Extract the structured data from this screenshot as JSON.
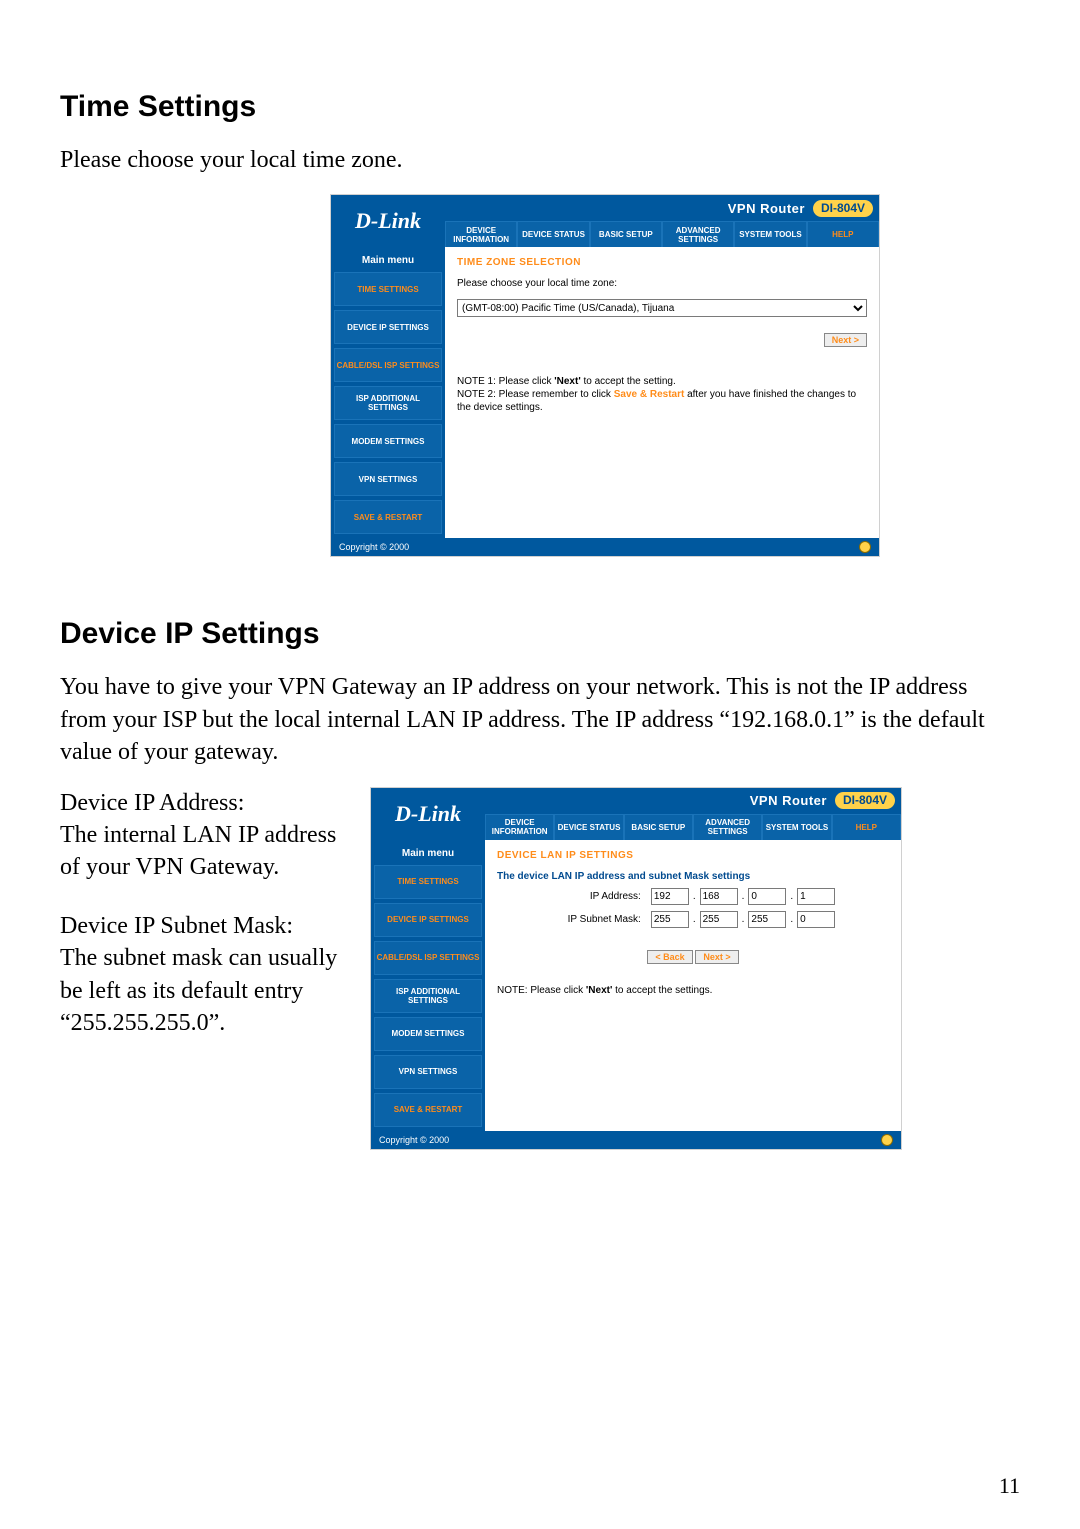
{
  "page_number": "11",
  "sec1": {
    "heading": "Time Settings",
    "intro": "Please choose your local time zone."
  },
  "sec2": {
    "heading": "Device IP Settings",
    "intro": "You have to give your VPN Gateway an IP address on your network. This is not the IP address from your ISP but the local internal LAN IP address. The IP address “192.168.0.1” is the default value of your gateway.",
    "left1_label": "Device IP Address:",
    "left1_body": "The internal LAN IP address of your VPN Gateway.",
    "left2_label": "Device IP Subnet Mask:",
    "left2_body": "The subnet mask can usually be left as its default entry “255.255.255.0”."
  },
  "router": {
    "logo": "D-Link",
    "title": "VPN Router",
    "model": "DI-804V",
    "tabs": [
      "DEVICE INFORMATION",
      "DEVICE STATUS",
      "BASIC SETUP",
      "ADVANCED SETTINGS",
      "SYSTEM TOOLS",
      "HELP"
    ],
    "sidebar_title": "Main menu",
    "sidebar": [
      "TIME SETTINGS",
      "DEVICE IP SETTINGS",
      "CABLE/DSL ISP SETTINGS",
      "ISP ADDITIONAL SETTINGS",
      "MODEM SETTINGS",
      "VPN SETTINGS",
      "SAVE & RESTART"
    ],
    "copyright": "Copyright © 2000"
  },
  "tz": {
    "title": "TIME ZONE SELECTION",
    "prompt": "Please choose your local time zone:",
    "selected": "(GMT-08:00) Pacific Time (US/Canada), Tijuana",
    "next_label": "Next >",
    "note1_a": "NOTE 1: Please click ",
    "note1_b": "'Next'",
    "note1_c": " to accept the setting.",
    "note2_a": "NOTE 2: Please remember to click ",
    "note2_b": "Save & Restart",
    "note2_c": " after you have finished the changes to the device settings."
  },
  "ip": {
    "title": "DEVICE LAN IP SETTINGS",
    "subtitle": "The device LAN IP address and subnet Mask settings",
    "ip_label": "IP Address:",
    "mask_label": "IP Subnet Mask:",
    "ip": [
      "192",
      "168",
      "0",
      "1"
    ],
    "mask": [
      "255",
      "255",
      "255",
      "0"
    ],
    "back_label": "< Back",
    "next_label": "Next >",
    "note_a": "NOTE: Please click ",
    "note_b": "'Next'",
    "note_c": " to accept the settings."
  }
}
